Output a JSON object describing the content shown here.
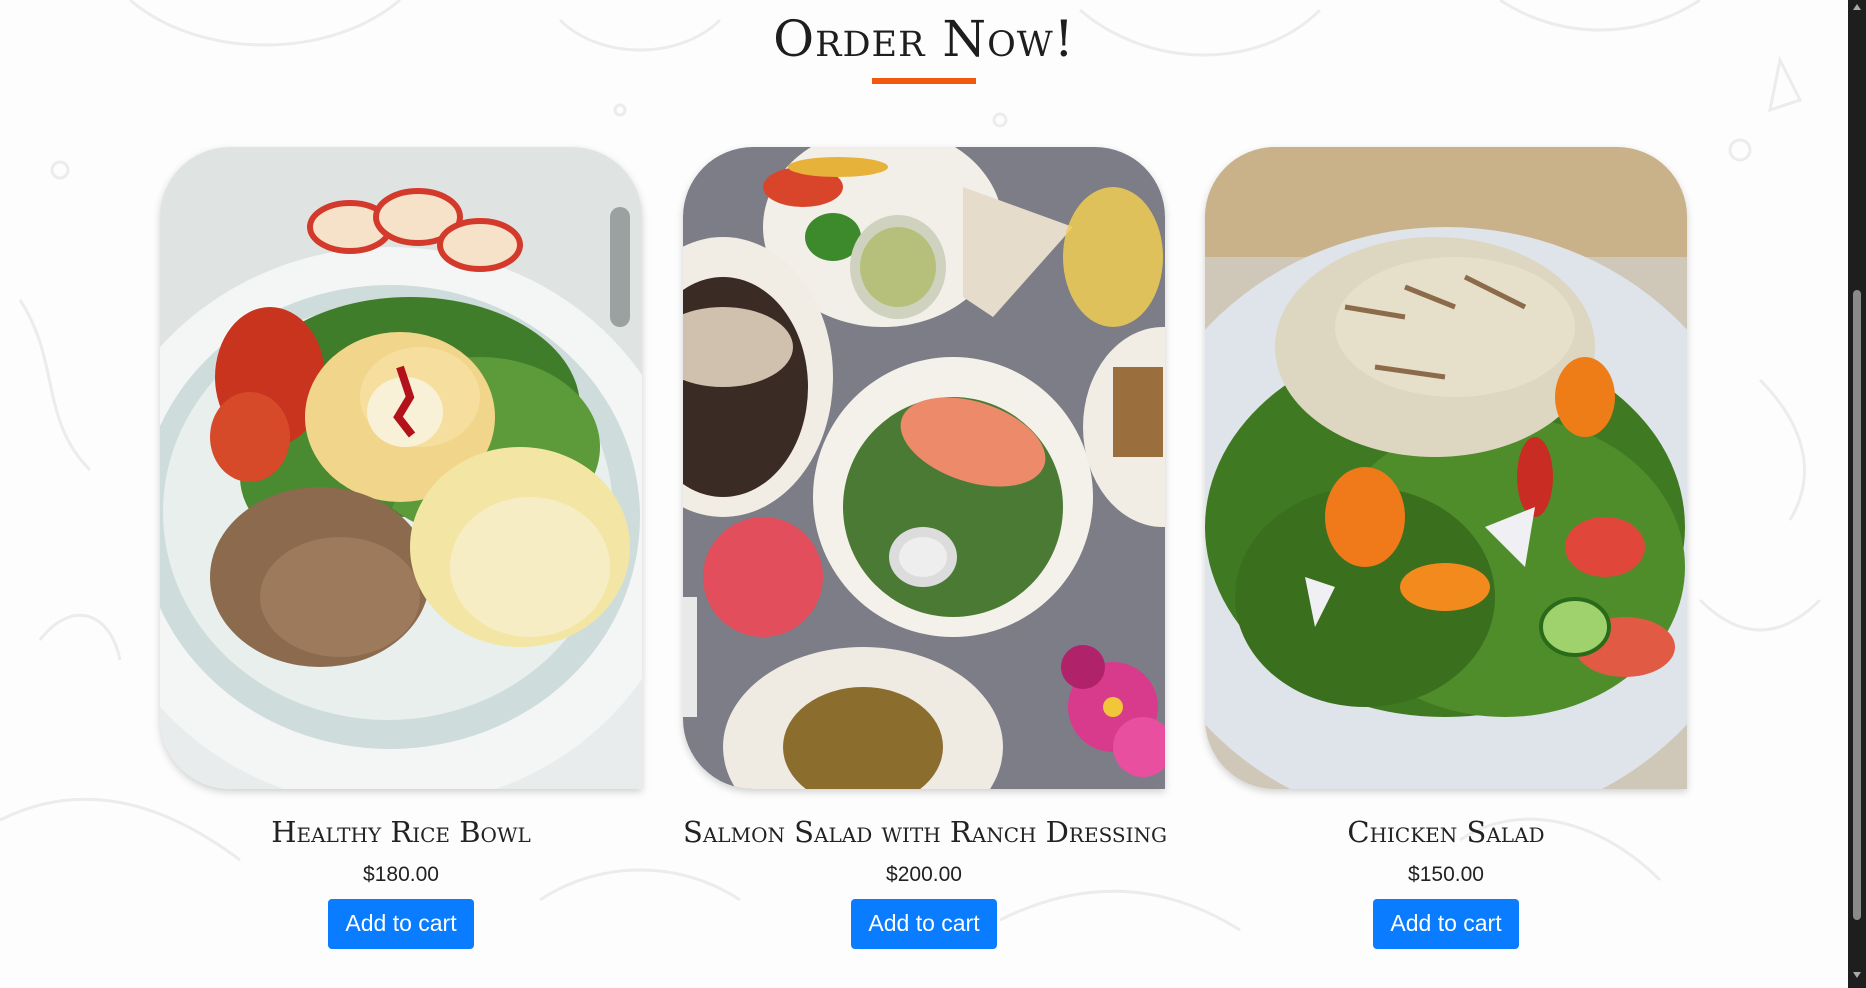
{
  "section": {
    "title": "Order Now!",
    "accent_color": "#f15a0e"
  },
  "products": [
    {
      "name": "Healthy Rice Bowl",
      "price": "$180.00",
      "button_label": "Add to cart",
      "image": "rice-bowl-photo"
    },
    {
      "name": "Salmon Salad with Ranch Dressing",
      "price": "$200.00",
      "button_label": "Add to cart",
      "image": "salmon-salad-photo"
    },
    {
      "name": "Chicken Salad",
      "price": "$150.00",
      "button_label": "Add to cart",
      "image": "chicken-salad-photo"
    }
  ],
  "colors": {
    "button": "#0a7cff",
    "button_text": "#ffffff"
  }
}
